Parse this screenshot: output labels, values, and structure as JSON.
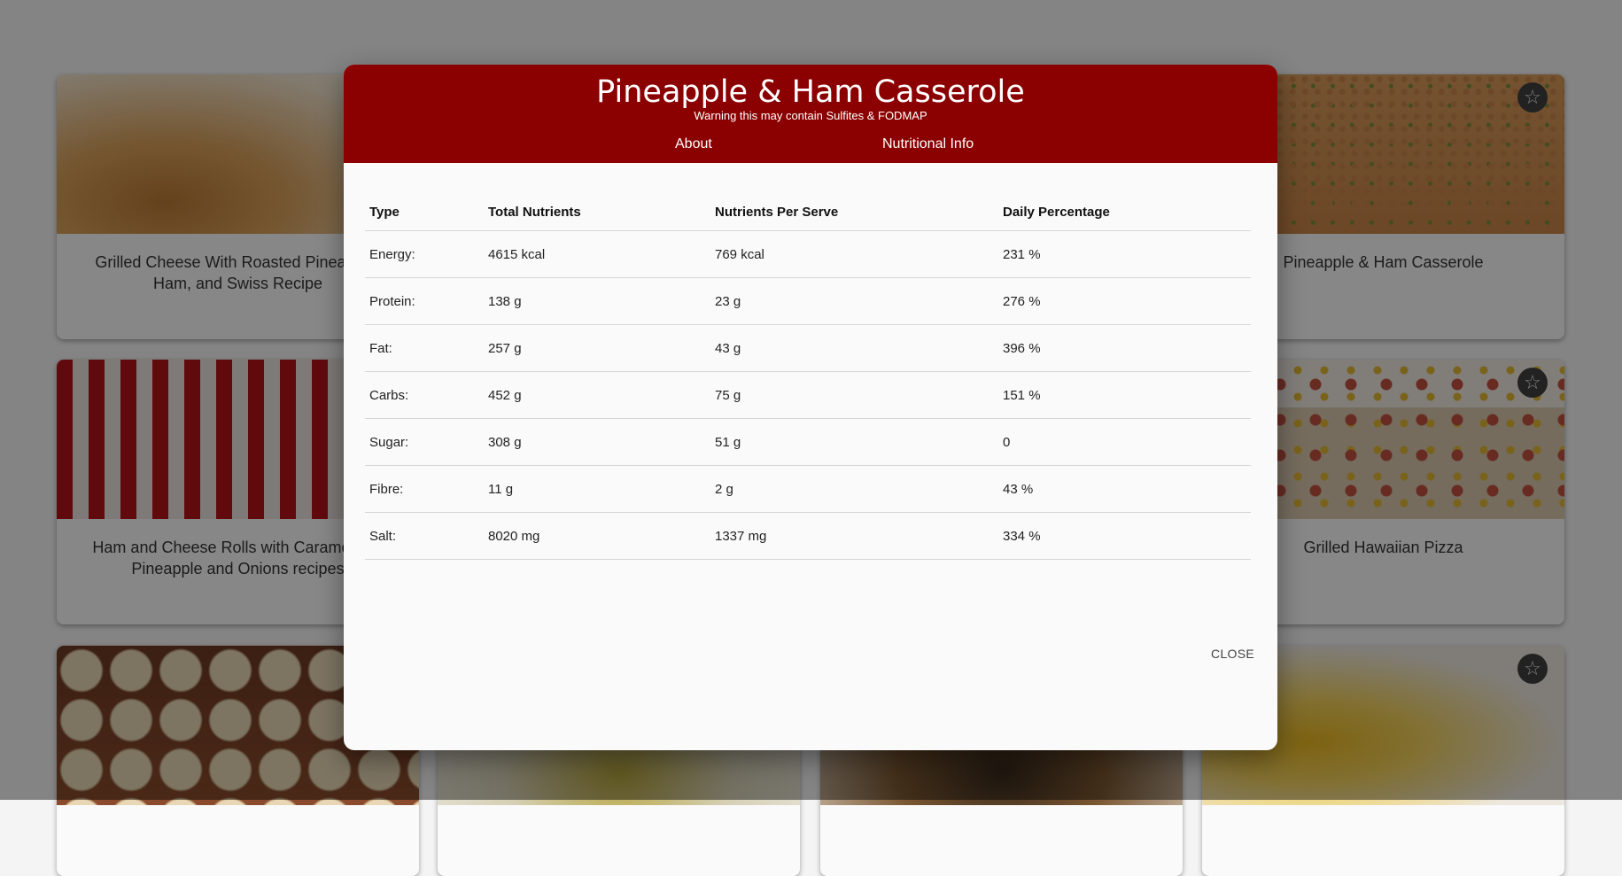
{
  "recipes": [
    {
      "title": "Grilled Cheese With Roasted Pineapple, Ham, and Swiss Recipe"
    },
    {
      "title": "Pineapple & Ham Casserole"
    },
    {
      "title": "Ham and Cheese Rolls with Caramelized Pineapple and Onions recipes"
    },
    {
      "title": "Grilled Hawaiian Pizza"
    }
  ],
  "modal": {
    "title": "Pineapple & Ham Casserole",
    "warning": "Warning this may contain Sulfites & FODMAP",
    "tabs": [
      {
        "label": "About"
      },
      {
        "label": "Nutritional Info"
      }
    ],
    "active_tab": "Nutritional Info",
    "table": {
      "headers": [
        "Type",
        "Total Nutrients",
        "Nutrients Per Serve",
        "Daily Percentage"
      ],
      "rows": [
        [
          "Energy:",
          "4615 kcal",
          "769 kcal",
          "231 %"
        ],
        [
          "Protein:",
          "138 g",
          "23 g",
          "276 %"
        ],
        [
          "Fat:",
          "257 g",
          "43 g",
          "396 %"
        ],
        [
          "Carbs:",
          "452 g",
          "75 g",
          "151 %"
        ],
        [
          "Sugar:",
          "308 g",
          "51 g",
          "0"
        ],
        [
          "Fibre:",
          "11 g",
          "2 g",
          "43 %"
        ],
        [
          "Salt:",
          "8020 mg",
          "1337 mg",
          "334 %"
        ]
      ]
    },
    "close_label": "CLOSE"
  },
  "colors": {
    "header_bg": "#8b0000",
    "overlay": "rgba(0,0,0,0.46)"
  }
}
